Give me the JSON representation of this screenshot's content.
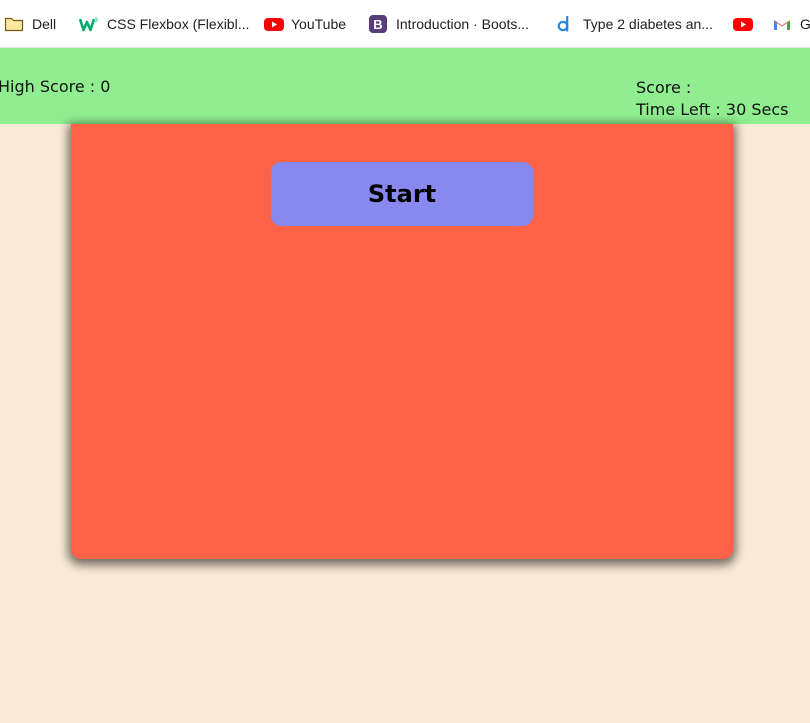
{
  "bookmarks": [
    {
      "label": "Dell",
      "icon": "folder-icon"
    },
    {
      "label": "CSS Flexbox (Flexibl...",
      "icon": "w3schools-icon"
    },
    {
      "label": "YouTube",
      "icon": "youtube-icon"
    },
    {
      "label": "Introduction · Boots...",
      "icon": "bootstrap-icon"
    },
    {
      "label": "Type 2 diabetes an...",
      "icon": "site-d-icon"
    },
    {
      "label": "",
      "icon": "youtube-icon"
    },
    {
      "label": "G",
      "icon": "gmail-icon"
    }
  ],
  "header": {
    "high_score": "High Score : 0",
    "score": "Score :",
    "time_left": "Time Left : 30 Secs"
  },
  "game": {
    "start_label": "Start"
  },
  "colors": {
    "page_bg": "#FAEBD7",
    "header_bg": "#90EE90",
    "board_bg": "#FF6347",
    "button_bg": "#8888EE"
  }
}
